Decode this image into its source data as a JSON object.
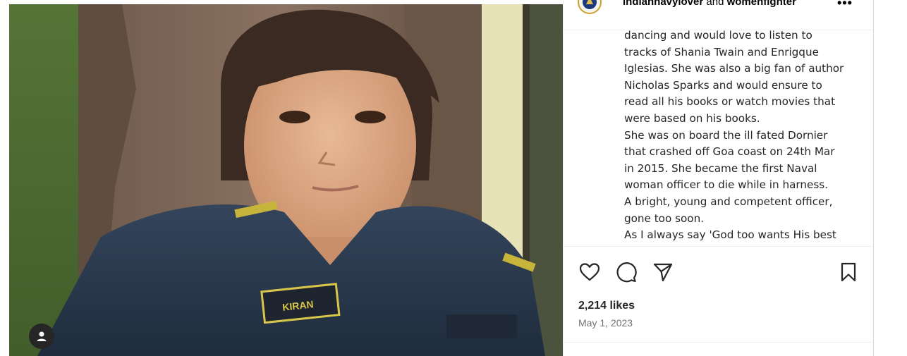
{
  "header": {
    "author1": "indiannavylover",
    "joiner": " and ",
    "author2": "womenfighter",
    "more_label": "•••",
    "avatar_icon": "navy-emblem-icon"
  },
  "photo": {
    "name_patch": "KIRAN",
    "tag_icon": "user-tag-icon"
  },
  "caption": {
    "lines": [
      "dancing and would love to listen to",
      "tracks of Shania Twain and Enrigque",
      "Iglesias. She was also a big fan of author",
      "Nicholas Sparks and would ensure to",
      "read all his books or watch movies that",
      "were based on his books.",
      "She was on board the ill fated Dornier",
      "that crashed off Goa coast on 24th Mar",
      "in 2015. She became the first Naval",
      "woman officer to die while in harness.",
      "A bright, young and competent officer,",
      "gone too soon.",
      "As I always say 'God too wants His best"
    ]
  },
  "actions": {
    "like_icon": "heart-icon",
    "comment_icon": "comment-icon",
    "share_icon": "send-icon",
    "save_icon": "bookmark-icon"
  },
  "stats": {
    "likes": "2,214 likes",
    "date": "May 1, 2023"
  },
  "colors": {
    "text": "#262626",
    "muted": "#737373",
    "divider": "#efefef"
  }
}
